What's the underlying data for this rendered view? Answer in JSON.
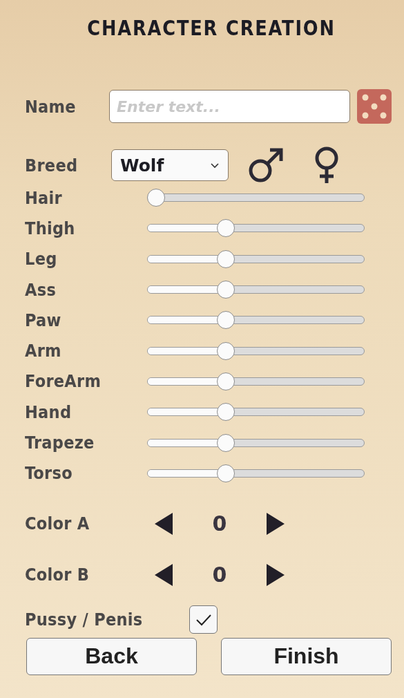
{
  "title": "CHARACTER CREATION",
  "name": {
    "label": "Name",
    "placeholder": "Enter text..."
  },
  "breed": {
    "label": "Breed",
    "value": "Wolf"
  },
  "sliders": [
    {
      "label": "Hair",
      "level": 0.0
    },
    {
      "label": "Thigh",
      "level": 0.35
    },
    {
      "label": "Leg",
      "level": 0.35
    },
    {
      "label": "Ass",
      "level": 0.35
    },
    {
      "label": "Paw",
      "level": 0.35
    },
    {
      "label": "Arm",
      "level": 0.35
    },
    {
      "label": "ForeArm",
      "level": 0.35
    },
    {
      "label": "Hand",
      "level": 0.35
    },
    {
      "label": "Trapeze",
      "level": 0.35
    },
    {
      "label": "Torso",
      "level": 0.35
    }
  ],
  "colors": [
    {
      "label": "Color A",
      "value": "0"
    },
    {
      "label": "Color B",
      "value": "0"
    }
  ],
  "toggle": {
    "label": "Pussy / Penis",
    "checked": true
  },
  "buttons": [
    "Back",
    "Finish"
  ]
}
